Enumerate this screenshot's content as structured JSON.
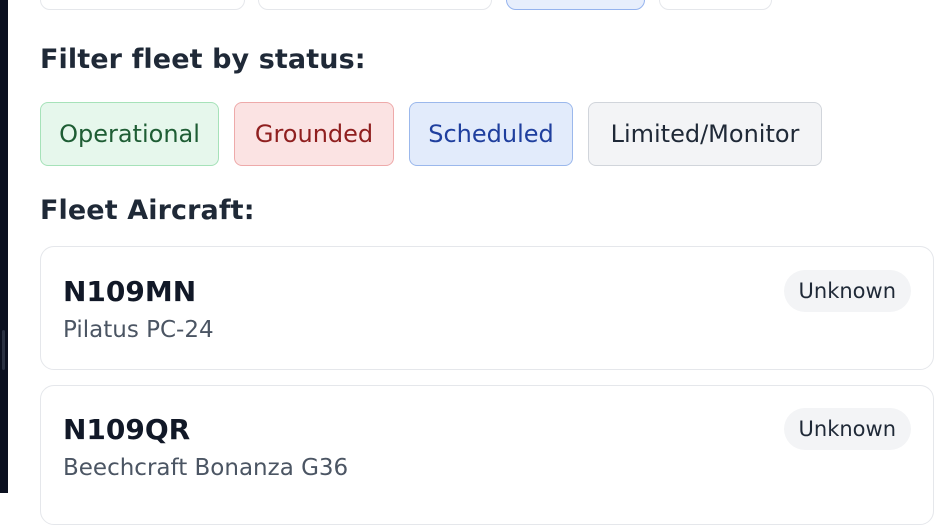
{
  "filters": {
    "title": "Filter fleet by status:",
    "buttons": [
      {
        "label": "Operational"
      },
      {
        "label": "Grounded"
      },
      {
        "label": "Scheduled"
      },
      {
        "label": "Limited/Monitor"
      }
    ]
  },
  "fleet": {
    "title": "Fleet Aircraft:",
    "aircraft": [
      {
        "registration": "N109MN",
        "model": "Pilatus PC-24",
        "status": "Unknown"
      },
      {
        "registration": "N109QR",
        "model": "Beechcraft Bonanza G36",
        "status": "Unknown"
      }
    ]
  },
  "colors": {
    "operational": "#e6f7ec",
    "grounded": "#fbe3e3",
    "scheduled": "#e2ebfb",
    "limited": "#f3f4f6"
  }
}
